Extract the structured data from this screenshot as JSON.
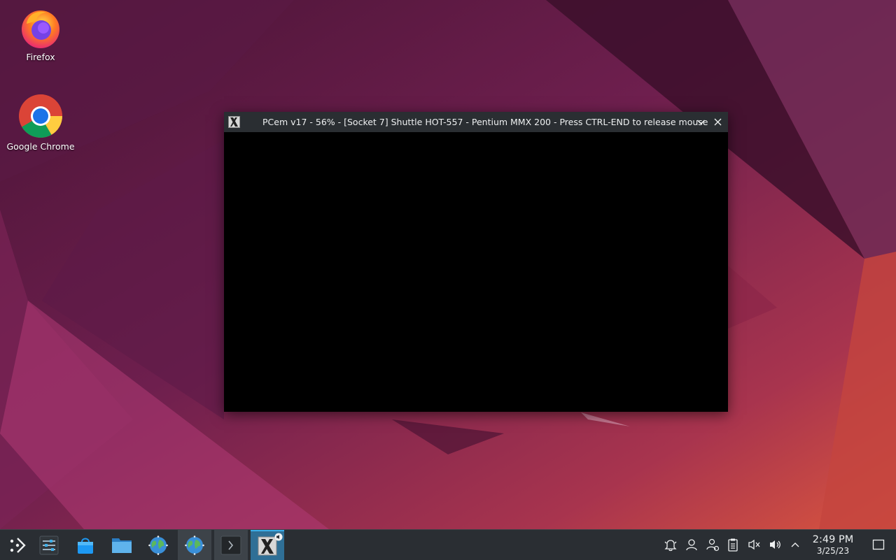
{
  "desktop": {
    "icons": [
      {
        "label": "Firefox",
        "icon": "firefox-icon"
      },
      {
        "label": "Google Chrome",
        "icon": "chrome-icon"
      }
    ]
  },
  "window": {
    "app_icon": "x-app-icon",
    "title": "PCem v17 - 56% - [Socket 7] Shuttle HOT-557 - Pentium MMX 200 - Press CTRL-END to release mouse",
    "buttons": [
      "minimize-chevron-icon",
      "close-icon"
    ]
  },
  "taskbar": {
    "launchers": [
      {
        "name": "application-launcher",
        "icon": "launcher-icon"
      },
      {
        "name": "system-settings",
        "icon": "settings-sliders-icon"
      },
      {
        "name": "discover-store",
        "icon": "store-bag-icon"
      },
      {
        "name": "file-manager",
        "icon": "folder-icon"
      },
      {
        "name": "web-browser",
        "icon": "globe-icon"
      },
      {
        "name": "web-browser-2",
        "icon": "globe-icon"
      },
      {
        "name": "terminal",
        "icon": "terminal-icon"
      },
      {
        "name": "pcem-task",
        "icon": "x-app-icon"
      }
    ],
    "tray": [
      "notifications-icon",
      "user-icon",
      "network-user-icon",
      "clipboard-icon",
      "muted-speaker-icon",
      "volume-icon",
      "expand-tray-icon"
    ],
    "clock": {
      "time": "2:49 PM",
      "date": "3/25/23"
    }
  },
  "colors": {
    "accent": "#3daee9",
    "panel": "#2a2e33",
    "titlebar": "#2a2e32"
  }
}
